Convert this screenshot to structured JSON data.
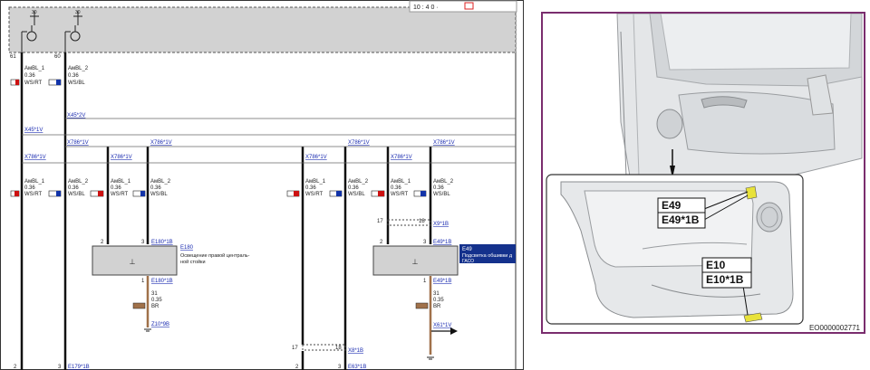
{
  "header_controls": "10 : 4 0 ·",
  "pin_top_left": "61",
  "pin_top_right": "60",
  "left_block_labels": [
    "AмBL_1",
    "0.36",
    "WS/RT",
    "AмBL_2",
    "0.36",
    "WS/BL"
  ],
  "connectors": {
    "x45_2v": "X45*2V",
    "x45_1v": "X45*1V",
    "x786_1v_a": "X786*1V",
    "x786_1v_b": "X786*1V",
    "x786_1v_c": "X786*1V",
    "x786_1v_d": "X786*1V",
    "x786_1v_e": "X786*1V",
    "x786_1v_f": "X786*1V",
    "x786_1v_g": "X786*1V",
    "x786_1v_h": "X786*1V",
    "x9_1b": "X9*1B",
    "x8_1b": "X8*1B",
    "x61_1v": "X61*1V",
    "e180_1b_top": "E180*1B",
    "e180_1b_bot": "E180*1B",
    "e49_1b_top": "E49*1B",
    "e49_1b_bot": "E49*1B",
    "z10_9b": "Z10*9B",
    "e179_1b": "E179*1B",
    "e63_1b": "E63*1B"
  },
  "wires": {
    "ambl1": "AмBL_1",
    "ambl2": "AмBL_2",
    "size": "0.36",
    "ws_rt": "WS/RT",
    "ws_bl": "WS/BL",
    "br_num": "31",
    "br_size": "0.35",
    "br": "BR"
  },
  "pins": {
    "p2": "2",
    "p3": "3",
    "p1": "1",
    "p17": "17",
    "p18": "18"
  },
  "component_e180": {
    "id": "E180",
    "desc_line1": "Освещение правой централь-",
    "desc_line2": "ной стойки"
  },
  "component_e49": {
    "id": "E49",
    "desc_line1": "Подсветка обшивки д",
    "desc_line2": "ГАСО"
  },
  "right_panel": {
    "label_e49": "E49",
    "label_e49_1b": "E49*1B",
    "label_e10": "E10",
    "label_e10_1b": "E10*1B",
    "caption": "EO0000002771"
  }
}
